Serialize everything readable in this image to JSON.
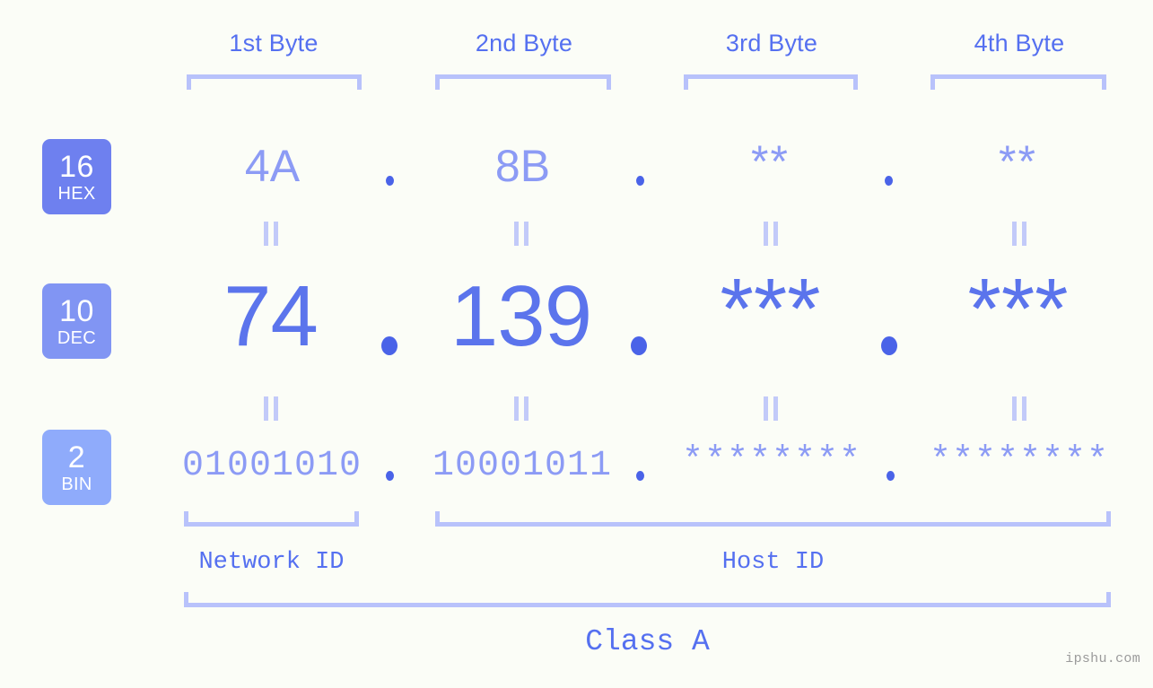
{
  "background_color": "#fbfdf7",
  "accent_color": "#5570f0",
  "muted_accent_color": "#8c9bf5",
  "bracket_color": "#b8c2fb",
  "byte_headers": [
    {
      "label": "1st Byte"
    },
    {
      "label": "2nd Byte"
    },
    {
      "label": "3rd Byte"
    },
    {
      "label": "4th Byte"
    }
  ],
  "bases": [
    {
      "number": "16",
      "name": "HEX",
      "color": "#6e80ef"
    },
    {
      "number": "10",
      "name": "DEC",
      "color": "#8195f3"
    },
    {
      "number": "2",
      "name": "BIN",
      "color": "#8fabfb"
    }
  ],
  "rows": {
    "hex": {
      "base_number": "16",
      "base_name": "HEX",
      "values": [
        "4A",
        "8B",
        "**",
        "**"
      ],
      "separator": "."
    },
    "dec": {
      "base_number": "10",
      "base_name": "DEC",
      "values": [
        "74",
        "139",
        "***",
        "***"
      ],
      "separator": "."
    },
    "bin": {
      "base_number": "2",
      "base_name": "BIN",
      "values": [
        "01001010",
        "10001011",
        "********",
        "********"
      ],
      "separator": "."
    }
  },
  "equality_symbol": "=",
  "sections": [
    {
      "label": "Network ID"
    },
    {
      "label": "Host ID"
    }
  ],
  "class_label": "Class A",
  "watermark": "ipshu.com"
}
